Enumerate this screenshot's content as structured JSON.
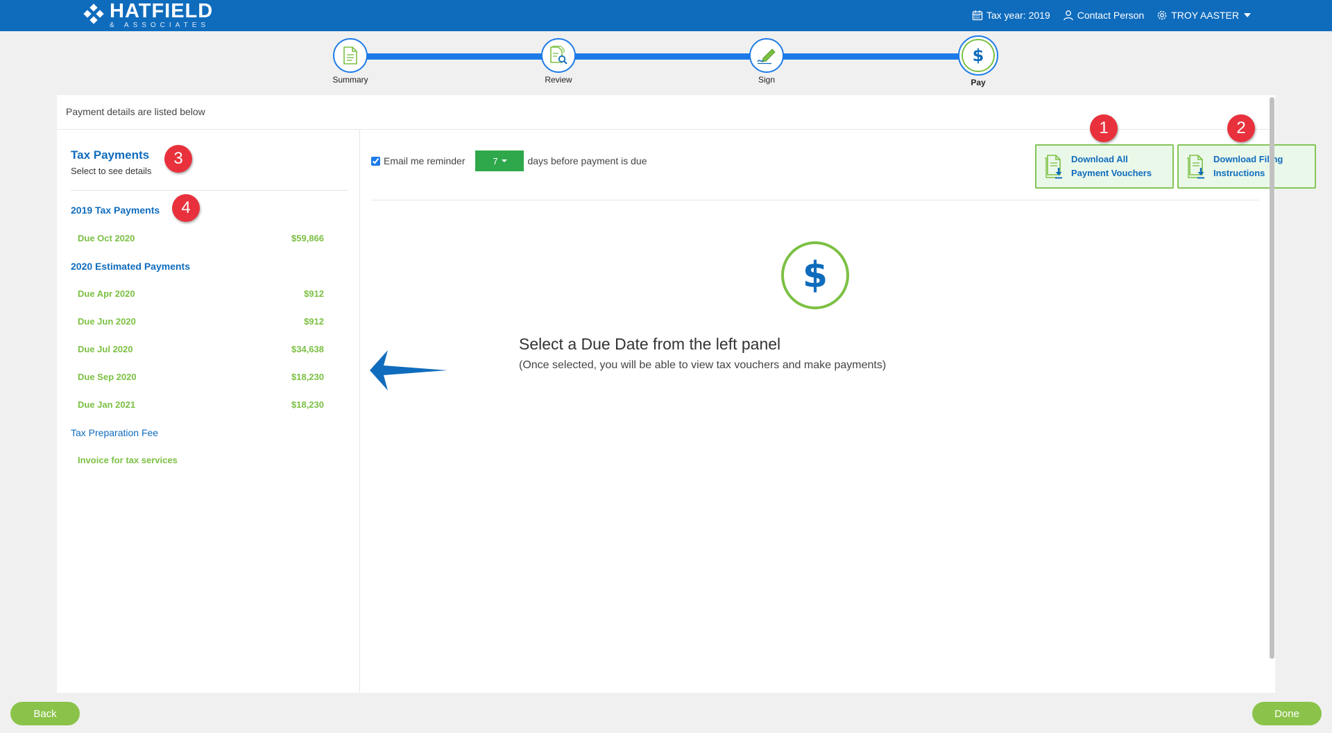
{
  "header": {
    "logo_title": "HATFIELD",
    "logo_sub": "& ASSOCIATES",
    "tax_year": "Tax year: 2019",
    "contact": "Contact Person",
    "user": "TROY AASTER"
  },
  "stepper": {
    "steps": [
      {
        "label": "Summary"
      },
      {
        "label": "Review"
      },
      {
        "label": "Sign"
      },
      {
        "label": "Pay"
      }
    ],
    "active": "Pay"
  },
  "card": {
    "header_text": "Payment details are listed below"
  },
  "left_panel": {
    "title": "Tax Payments",
    "subtitle": "Select to see details",
    "group1": {
      "label": "2019 Tax Payments",
      "items": [
        {
          "label": "Due Oct 2020",
          "amount": "$59,866"
        }
      ]
    },
    "group2": {
      "label": "2020 Estimated Payments",
      "items": [
        {
          "label": "Due Apr 2020",
          "amount": "$912"
        },
        {
          "label": "Due Jun 2020",
          "amount": "$912"
        },
        {
          "label": "Due Jul 2020",
          "amount": "$34,638"
        },
        {
          "label": "Due Sep 2020",
          "amount": "$18,230"
        },
        {
          "label": "Due Jan 2021",
          "amount": "$18,230"
        }
      ]
    },
    "group3": {
      "label": "Tax Preparation Fee",
      "items": [
        {
          "label": "Invoice for tax services"
        }
      ]
    }
  },
  "right_panel": {
    "reminder_label": "Email me reminder",
    "reminder_days": "7",
    "reminder_suffix": "days before payment is due",
    "download_vouchers": [
      "Download All",
      "Payment Vouchers"
    ],
    "download_instructions": [
      "Download Filing",
      "Instructions"
    ],
    "empty_title": "Select a Due Date from the left panel",
    "empty_sub": "(Once selected, you will be able to view tax vouchers and make payments)",
    "dollar_symbol": "$"
  },
  "badges": [
    "1",
    "2",
    "3",
    "4"
  ],
  "footer": {
    "back": "Back",
    "done": "Done"
  },
  "colors": {
    "brand_blue": "#0f6cbd",
    "accent_green": "#7cc043",
    "badge_red": "#e8313c",
    "button_green": "#8bc34a"
  }
}
